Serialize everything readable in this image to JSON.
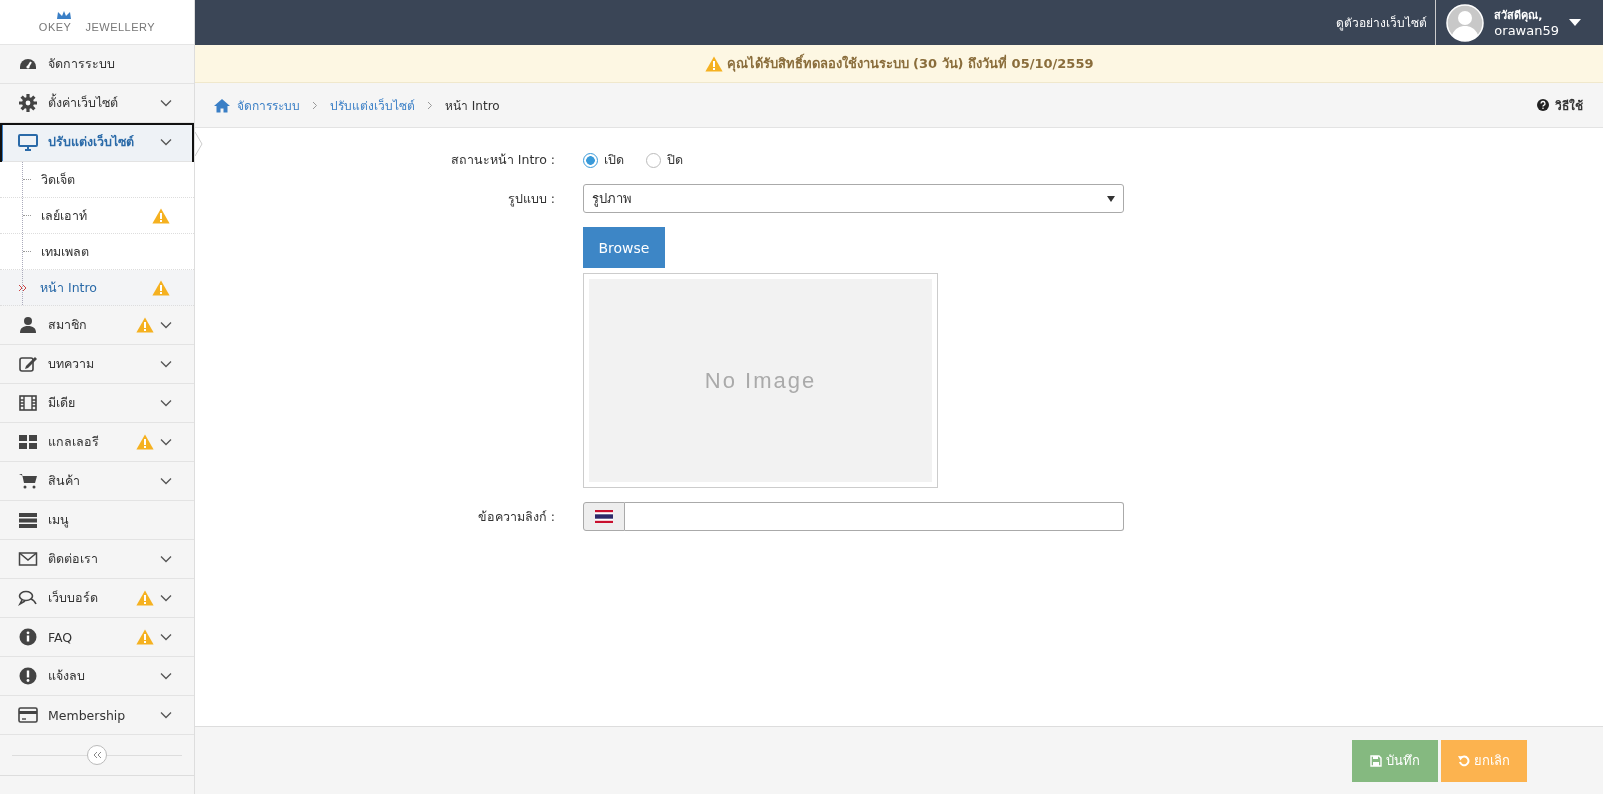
{
  "logo": {
    "left": "OKEY",
    "right": "JEWELLERY"
  },
  "topbar": {
    "preview_link": "ดูตัวอย่างเว็บไซต์",
    "greeting": "สวัสดีคุณ,",
    "username": "orawan59"
  },
  "sidebar": {
    "items": [
      {
        "label": "จัดการระบบ",
        "warning": false,
        "has_caret": false,
        "selected": false,
        "expanded": false
      },
      {
        "label": "ตั้งค่าเว็บไซต์",
        "warning": false,
        "has_caret": true,
        "selected": false,
        "expanded": false
      },
      {
        "label": "ปรับแต่งเว็บไซต์",
        "warning": false,
        "has_caret": true,
        "selected": true,
        "expanded": true,
        "children": [
          {
            "label": "วิดเจ็ต",
            "warning": false,
            "selected": false
          },
          {
            "label": "เลย์เอาท์",
            "warning": true,
            "selected": false
          },
          {
            "label": "เทมเพลต",
            "warning": false,
            "selected": false
          },
          {
            "label": "หน้า Intro",
            "warning": true,
            "selected": true
          }
        ]
      },
      {
        "label": "สมาชิก",
        "warning": true,
        "has_caret": true,
        "selected": false,
        "expanded": false
      },
      {
        "label": "บทความ",
        "warning": false,
        "has_caret": true,
        "selected": false,
        "expanded": false
      },
      {
        "label": "มีเดีย",
        "warning": false,
        "has_caret": true,
        "selected": false,
        "expanded": false
      },
      {
        "label": "แกลเลอรี",
        "warning": true,
        "has_caret": true,
        "selected": false,
        "expanded": false
      },
      {
        "label": "สินค้า",
        "warning": false,
        "has_caret": true,
        "selected": false,
        "expanded": false
      },
      {
        "label": "เมนู",
        "warning": false,
        "has_caret": false,
        "selected": false,
        "expanded": false
      },
      {
        "label": "ติดต่อเรา",
        "warning": false,
        "has_caret": true,
        "selected": false,
        "expanded": false
      },
      {
        "label": "เว็บบอร์ด",
        "warning": true,
        "has_caret": true,
        "selected": false,
        "expanded": false
      },
      {
        "label": "FAQ",
        "warning": true,
        "has_caret": true,
        "selected": false,
        "expanded": false
      },
      {
        "label": "แจ้งลบ",
        "warning": false,
        "has_caret": true,
        "selected": false,
        "expanded": false
      },
      {
        "label": "Membership",
        "warning": false,
        "has_caret": true,
        "selected": false,
        "expanded": false
      }
    ]
  },
  "banner": {
    "text": "คุณได้รับสิทธิ์ทดลองใช้งานระบบ (30 วัน) ถึงวันที่ 05/10/2559"
  },
  "breadcrumb": {
    "items": [
      "จัดการระบบ",
      "ปรับแต่งเว็บไซต์",
      "หน้า Intro"
    ],
    "help": "วิธีใช้"
  },
  "form": {
    "status": {
      "label": "สถานะหน้า Intro :",
      "options": [
        {
          "label": "เปิด",
          "selected": true
        },
        {
          "label": "ปิด",
          "selected": false
        }
      ]
    },
    "style": {
      "label": "รูปแบบ :",
      "value": "รูปภาพ"
    },
    "browse": "Browse",
    "preview": "No Image",
    "link_text": {
      "label": "ข้อความลิงก์ :"
    }
  },
  "footer": {
    "save": "บันทึก",
    "cancel": "ยกเลิก"
  }
}
